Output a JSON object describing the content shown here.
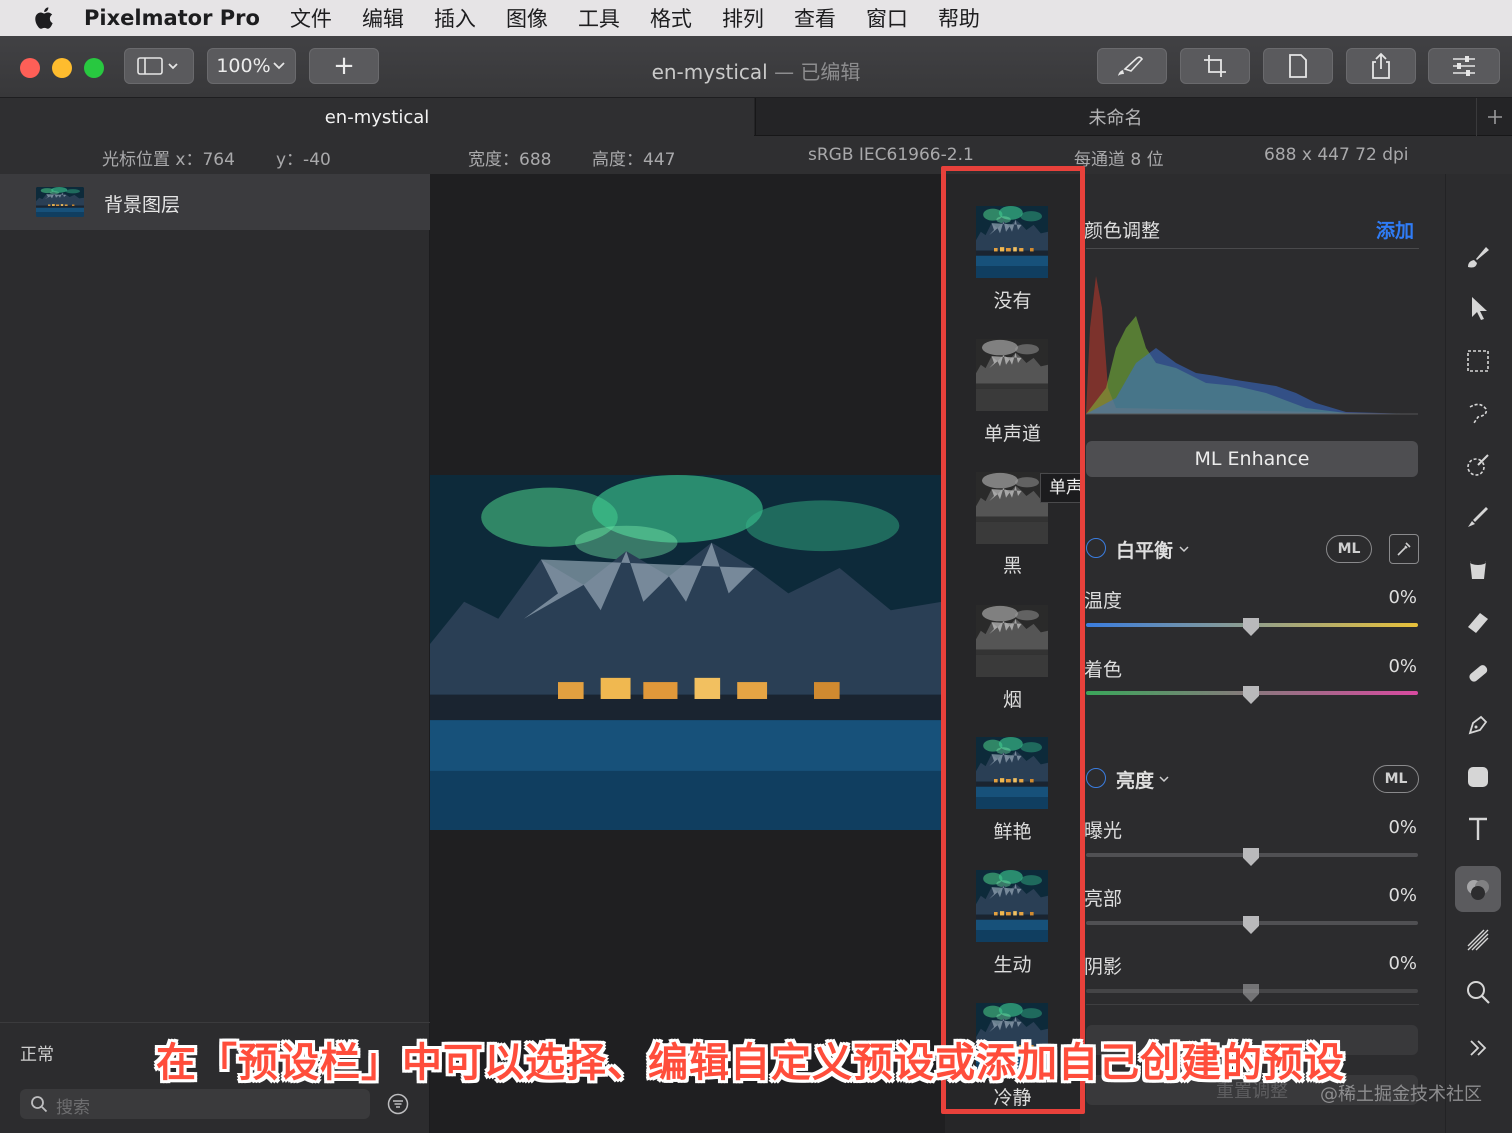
{
  "menubar": {
    "app_name": "Pixelmator Pro",
    "items": [
      "文件",
      "编辑",
      "插入",
      "图像",
      "工具",
      "格式",
      "排列",
      "查看",
      "窗口",
      "帮助"
    ]
  },
  "toolbar": {
    "zoom": "100%",
    "doc_name": "en-mystical",
    "doc_status": "— 已编辑",
    "add_label": "+"
  },
  "tabs": [
    "en-mystical",
    "未命名"
  ],
  "infobar": {
    "cursor_x": "光标位置 x：764",
    "cursor_y": "y：-40",
    "width": "宽度：688",
    "height": "高度：447",
    "color_profile": "sRGB IEC61966-2.1",
    "depth": "每通道 8 位",
    "size": "688 x 447 72 dpi"
  },
  "layers": {
    "items": [
      {
        "name": "背景图层"
      }
    ],
    "blend_mode": "正常",
    "search_placeholder": "搜索"
  },
  "presets": {
    "items": [
      {
        "label": "没有",
        "style": "color"
      },
      {
        "label": "单声道",
        "style": "mono"
      },
      {
        "label": "黑",
        "style": "mono"
      },
      {
        "label": "烟",
        "style": "mono"
      },
      {
        "label": "鲜艳",
        "style": "color"
      },
      {
        "label": "生动",
        "style": "color"
      },
      {
        "label": "冷静",
        "style": "color"
      }
    ],
    "tooltip": "单声道"
  },
  "adjustments": {
    "header": "颜色调整",
    "add": "添加",
    "ml_enhance": "ML Enhance",
    "white_balance": {
      "title": "白平衡",
      "ml": "ML",
      "temperature_label": "温度",
      "temperature_value": "0%",
      "tint_label": "着色",
      "tint_value": "0%"
    },
    "lightness": {
      "title": "亮度",
      "ml": "ML",
      "exposure_label": "曝光",
      "exposure_value": "0%",
      "highlights_label": "亮部",
      "highlights_value": "0%",
      "shadows_label": "阴影",
      "shadows_value": "0%"
    },
    "reset": "重置调整"
  },
  "caption": "在「预设栏」中可以选择、编辑自定义预设或添加自己创建的预设",
  "watermark": "@稀土掘金技术社区",
  "colors": {
    "accent_blue": "#2f7cf6",
    "highlight_red": "#e8413b"
  }
}
